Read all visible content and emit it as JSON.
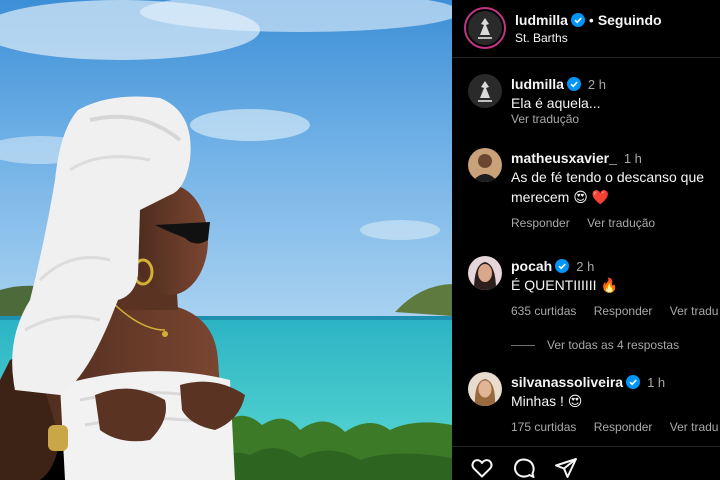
{
  "post": {
    "author": "ludmilla",
    "follow_separator": "•",
    "follow_status": "Seguindo",
    "location": "St. Barths"
  },
  "comments": [
    {
      "user": "ludmilla",
      "verified": true,
      "time": "2 h",
      "text": "Ela é aquela...",
      "actions": [
        "Ver tradução"
      ]
    },
    {
      "user": "matheusxavier_",
      "verified": false,
      "time": "1 h",
      "text": "As de fé tendo o descanso que merecem 😍 ❤️",
      "actions": [
        "Responder",
        "Ver tradução"
      ]
    },
    {
      "user": "pocah",
      "verified": true,
      "time": "2 h",
      "text": "É QUENTIIIIII 🔥",
      "actions": [
        "635 curtidas",
        "Responder",
        "Ver tradu"
      ]
    },
    {
      "user": "silvanassoliveira",
      "verified": true,
      "time": "1 h",
      "text": "Minhas ! 😍",
      "actions": [
        "175 curtidas",
        "Responder",
        "Ver tradu"
      ]
    }
  ],
  "replies_toggle": "Ver todas as 4 respostas",
  "icons": {
    "verified": "verified-badge-icon",
    "like": "heart-icon",
    "comment": "comment-bubble-icon",
    "share": "paper-plane-icon"
  },
  "colors": {
    "background": "#000000",
    "verified": "#0095f6",
    "secondary_text": "#a8a8a8",
    "story_ring": "#c13584"
  }
}
